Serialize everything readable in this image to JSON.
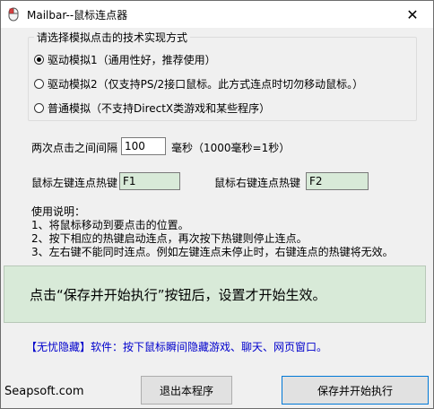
{
  "window": {
    "title": "Mailbar--鼠标连点器",
    "close_glyph": "✕"
  },
  "mode_group": {
    "legend": "请选择模拟点击的技术实现方式",
    "options": [
      {
        "label": "驱动模拟1（通用性好，推荐使用）",
        "checked": true
      },
      {
        "label": "驱动模拟2（仅支持PS/2接口鼠标。此方式连点时切勿移动鼠标。）",
        "checked": false
      },
      {
        "label": "普通模拟（不支持DirectX类游戏和某些程序）",
        "checked": false
      }
    ]
  },
  "interval": {
    "label": "两次点击之间间隔",
    "value": "100",
    "unit": "毫秒（1000毫秒=1秒）"
  },
  "hotkeys": {
    "left_label": "鼠标左键连点热键",
    "left_value": "F1",
    "right_label": "鼠标右键连点热键",
    "right_value": "F2"
  },
  "instructions": {
    "title": "使用说明：",
    "lines": [
      "1、将鼠标移动到要点击的位置。",
      "2、按下相应的热键启动连点，再次按下热键则停止连点。",
      "3、左右键不能同时连点。例如左键连点未停止时，右键连点的热键将无效。"
    ]
  },
  "notice": "点击“保存并开始执行”按钮后，设置才开始生效。",
  "ad": "【无忧隐藏】软件：按下鼠标瞬间隐藏游戏、聊天、网页窗口。",
  "brand": "Seapsoft.com",
  "buttons": {
    "exit": "退出本程序",
    "save": "保存并开始执行"
  },
  "colors": {
    "notice_bg": "#d8ead8",
    "ad_text": "#0000cc",
    "primary_border": "#0078d7"
  },
  "icons": {
    "app": "mouse-icon",
    "close": "close-icon"
  }
}
